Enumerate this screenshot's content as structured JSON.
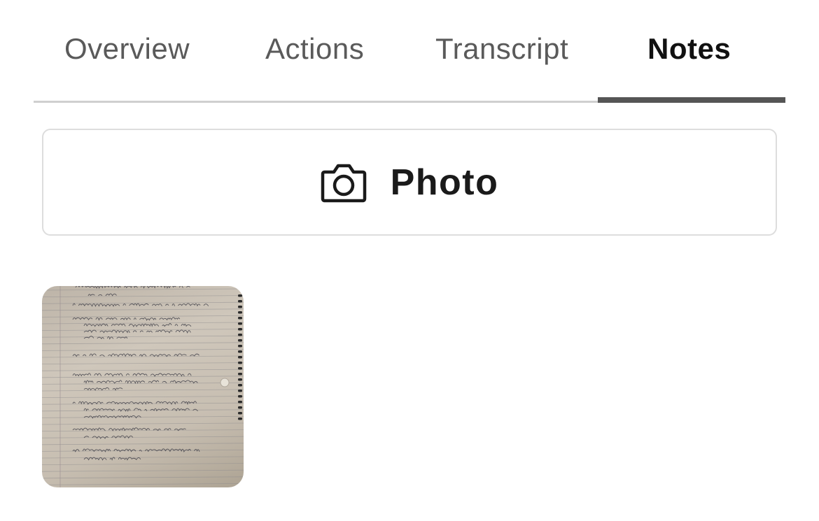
{
  "tabs": {
    "overview": "Overview",
    "actions": "Actions",
    "transcript": "Transcript",
    "notes": "Notes",
    "active": "notes"
  },
  "photo_button": {
    "label": "Photo",
    "icon": "camera-icon"
  },
  "attachments": [
    {
      "type": "photo",
      "description_icon": "handwritten-notes-thumbnail"
    }
  ],
  "colors": {
    "active_tab_text": "#111111",
    "inactive_tab_text": "#5a5a5a",
    "tab_indicator": "#555555",
    "tab_rule": "#cfcfcf",
    "button_border": "#dddddd"
  }
}
